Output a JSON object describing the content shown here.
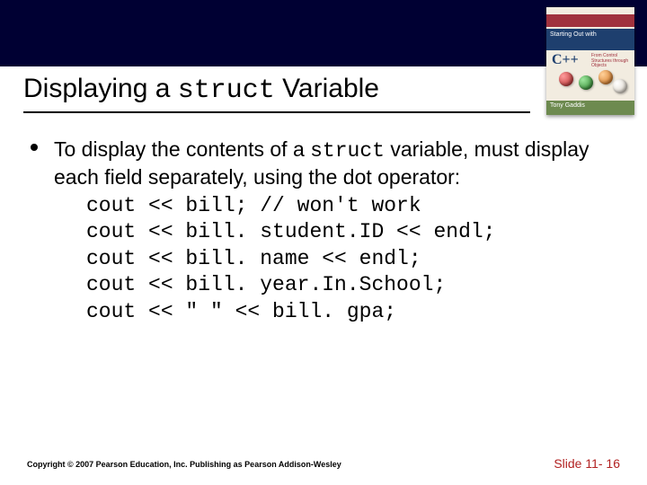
{
  "title": {
    "pre": "Displaying a ",
    "code": "struct",
    "post": " Variable"
  },
  "bullet": {
    "p1a": "To display the contents of a ",
    "p1code": "struct",
    "p1b": " variable, must display each field separately, using the dot operator:"
  },
  "code": {
    "l1": "cout << bill; // won't work",
    "l2": "cout << bill. student.ID << endl;",
    "l3": "cout << bill. name << endl;",
    "l4": "cout << bill. year.In.School;",
    "l5": "cout << \" \" << bill. gpa;"
  },
  "footer": {
    "copyright": "Copyright © 2007 Pearson Education, Inc. Publishing as Pearson Addison-Wesley",
    "slide": "Slide 11- 16"
  },
  "book": {
    "series": "Starting Out with",
    "lang": "C++",
    "sub": "From Control Structures through Objects",
    "author": "Tony Gaddis"
  }
}
